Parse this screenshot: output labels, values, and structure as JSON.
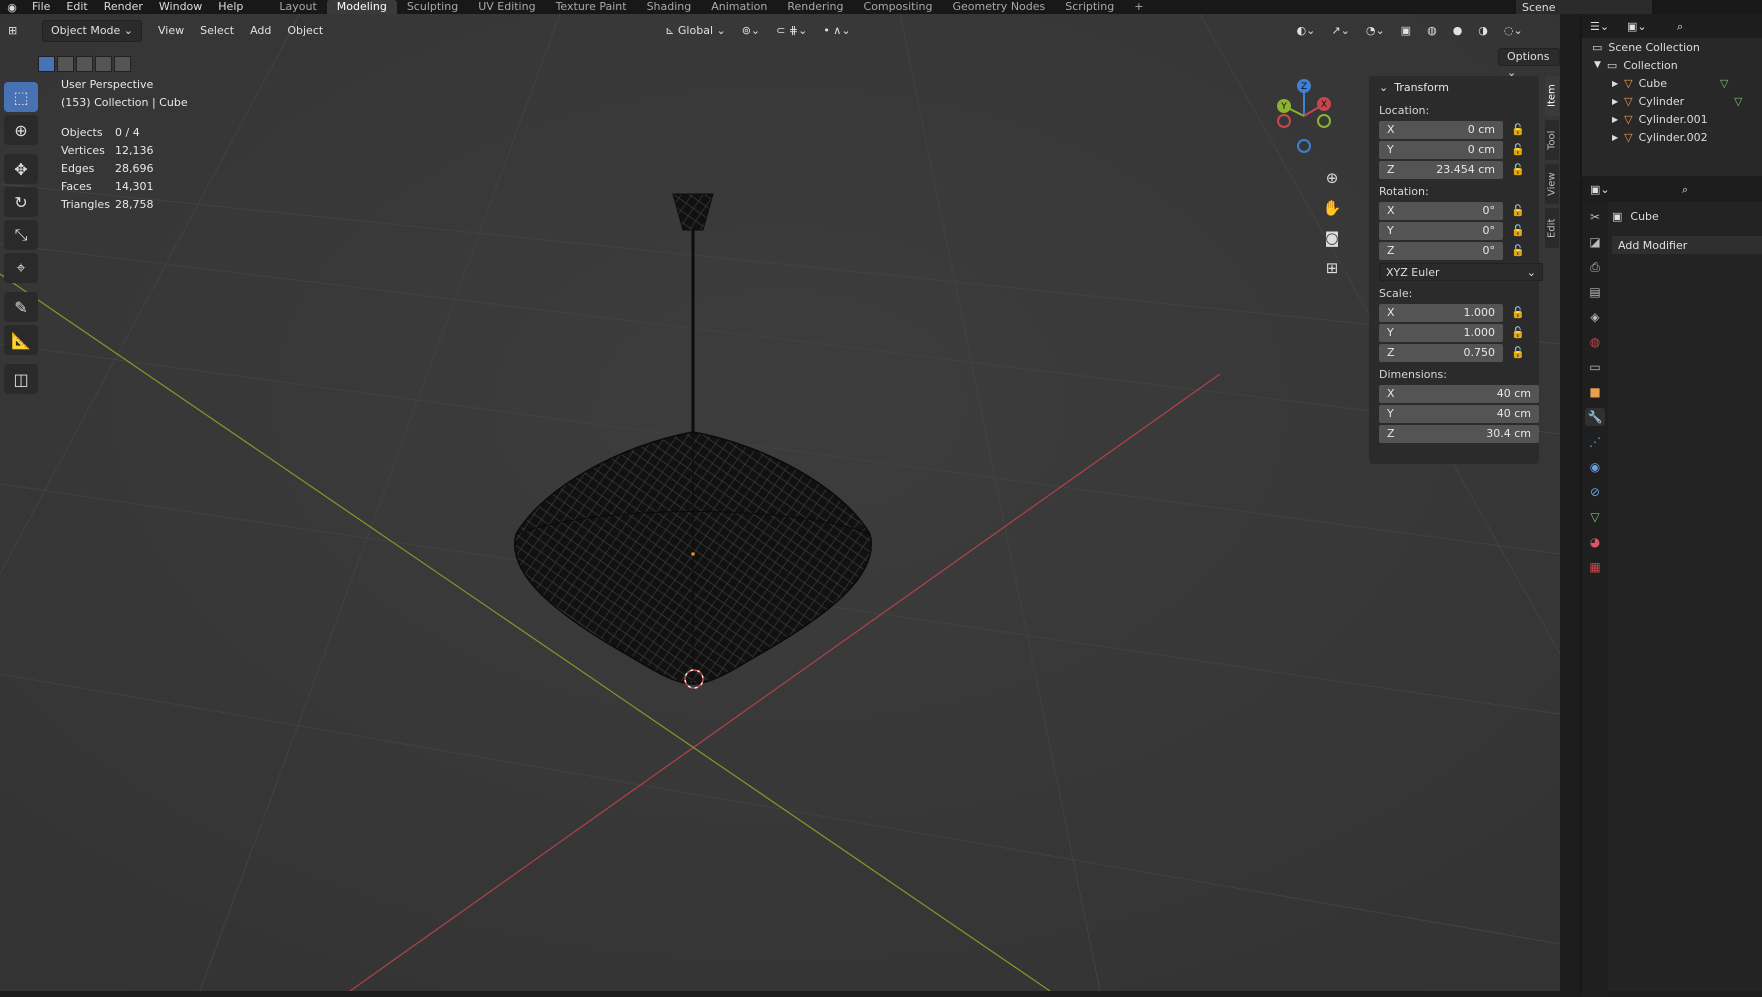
{
  "menus": [
    "File",
    "Edit",
    "Render",
    "Window",
    "Help"
  ],
  "workspaces": [
    "Layout",
    "Modeling",
    "Sculpting",
    "UV Editing",
    "Texture Paint",
    "Shading",
    "Animation",
    "Rendering",
    "Compositing",
    "Geometry Nodes",
    "Scripting"
  ],
  "scene_name": "Scene",
  "viewport_header": {
    "mode": "Object Mode",
    "menus": [
      "View",
      "Select",
      "Add",
      "Object"
    ],
    "orientation": "Global",
    "options_label": "Options"
  },
  "overlay": {
    "view_name": "User Perspective",
    "collection": "(153) Collection | Cube"
  },
  "stats": [
    {
      "label": "Objects",
      "value": "0 / 4"
    },
    {
      "label": "Vertices",
      "value": "12,136"
    },
    {
      "label": "Edges",
      "value": "28,696"
    },
    {
      "label": "Faces",
      "value": "14,301"
    },
    {
      "label": "Triangles",
      "value": "28,758"
    }
  ],
  "transform": {
    "title": "Transform",
    "location_label": "Location:",
    "location": [
      {
        "axis": "X",
        "value": "0 cm"
      },
      {
        "axis": "Y",
        "value": "0 cm"
      },
      {
        "axis": "Z",
        "value": "23.454 cm"
      }
    ],
    "rotation_label": "Rotation:",
    "rotation": [
      {
        "axis": "X",
        "value": "0°"
      },
      {
        "axis": "Y",
        "value": "0°"
      },
      {
        "axis": "Z",
        "value": "0°"
      }
    ],
    "rotation_mode": "XYZ Euler",
    "scale_label": "Scale:",
    "scale": [
      {
        "axis": "X",
        "value": "1.000"
      },
      {
        "axis": "Y",
        "value": "1.000"
      },
      {
        "axis": "Z",
        "value": "0.750"
      }
    ],
    "dimensions_label": "Dimensions:",
    "dimensions": [
      {
        "axis": "X",
        "value": "40 cm"
      },
      {
        "axis": "Y",
        "value": "40 cm"
      },
      {
        "axis": "Z",
        "value": "30.4 cm"
      }
    ]
  },
  "sidebar_tabs": [
    "Item",
    "Tool",
    "View",
    "Edit"
  ],
  "outliner": {
    "scene_collection": "Scene Collection",
    "collection": "Collection",
    "objects": [
      "Cube",
      "Cylinder",
      "Cylinder.001",
      "Cylinder.002"
    ]
  },
  "properties": {
    "object_name": "Cube",
    "add_modifier": "Add Modifier"
  },
  "colors": {
    "accent": "#4772b3",
    "x_axis": "#c9464e",
    "y_axis": "#8ab32f",
    "z_axis": "#3f80d4"
  }
}
